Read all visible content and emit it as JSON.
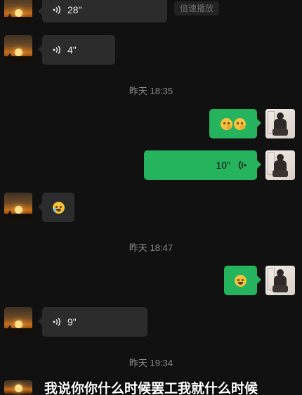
{
  "messages": {
    "m1_voice": "28\"",
    "speed_play": "倍速播放",
    "m2_voice": "4\"",
    "ts1": "昨天 18:35",
    "m4_voice": "10\"",
    "ts2": "昨天 18:47",
    "m7_voice": "9\"",
    "ts3": "昨天 19:34"
  },
  "subtitle": "我说你你什么时候罢工我就什么时候",
  "icons": {
    "voice_in": "voice-wave-icon",
    "voice_out": "voice-wave-icon",
    "emoji_thinking": "thinking-face-emoji",
    "emoji_laughing": "rolling-laughing-emoji",
    "emoji_smirk": "sweat-smile-emoji"
  },
  "colors": {
    "background": "#111111",
    "incoming_bubble": "#2c2c2c",
    "outgoing_bubble": "#26b35e",
    "timestamp": "#8a8a8a"
  }
}
